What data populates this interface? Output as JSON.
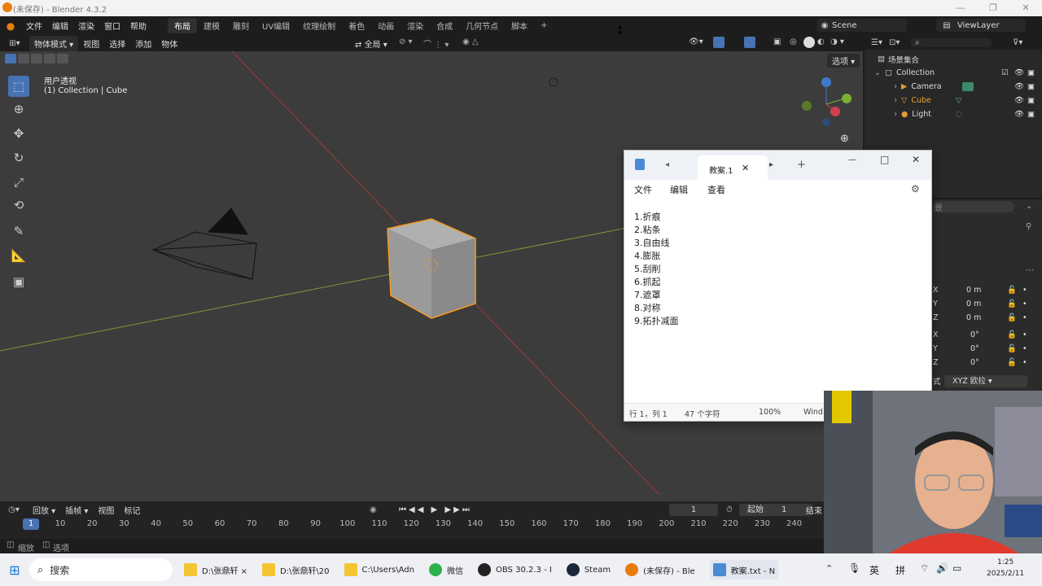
{
  "titlebar": {
    "title": "(未保存) - Blender 4.3.2"
  },
  "menu": [
    "文件",
    "编辑",
    "渲染",
    "窗口",
    "帮助"
  ],
  "workspaces": [
    "布局",
    "建模",
    "雕刻",
    "UV编辑",
    "纹理绘制",
    "着色",
    "动画",
    "渲染",
    "合成",
    "几何节点",
    "脚本"
  ],
  "scene": {
    "name": "Scene",
    "view_layer": "ViewLayer"
  },
  "viewport_header": {
    "mode": "物体模式",
    "menus": [
      "视图",
      "选择",
      "添加",
      "物体"
    ],
    "orientation": "全局",
    "options_label": "选项"
  },
  "viewport": {
    "view_name": "用户透视",
    "collection_info": "(1) Collection | Cube"
  },
  "outliner": {
    "root": "场景集合",
    "collection": "Collection",
    "items": [
      "Camera",
      "Cube",
      "Light"
    ]
  },
  "properties": {
    "axes": [
      "X",
      "Y",
      "Z",
      "X",
      "Y",
      "Z"
    ],
    "values": [
      "0 m",
      "0 m",
      "0 m",
      "0°",
      "0°",
      "0°"
    ],
    "rotation_mode": "XYZ 欧拉",
    "mode_suffix": "式",
    "cut_label": "景"
  },
  "notepad": {
    "tab_title": "教案.1",
    "menus": [
      "文件",
      "编辑",
      "查看"
    ],
    "lines": [
      "1.折痕",
      "2.粘条",
      "3.自由线",
      "4.膨胀",
      "5.刮削",
      "6.抓起",
      "7.遮罩",
      "8.对称",
      "9.拓扑减面"
    ],
    "status": {
      "position": "行 1，列 1",
      "chars": "47 个字符",
      "zoom": "100%",
      "encoding": "Wind"
    }
  },
  "timeline": {
    "menus": [
      "回放",
      "插帧",
      "视图",
      "标记"
    ],
    "current_frame": "1",
    "start_label": "起始",
    "start": "1",
    "end_label": "结束",
    "ticks": [
      "1",
      "10",
      "20",
      "30",
      "40",
      "50",
      "60",
      "70",
      "80",
      "90",
      "100",
      "110",
      "120",
      "130",
      "140",
      "150",
      "160",
      "170",
      "180",
      "190",
      "200",
      "210",
      "220",
      "230",
      "240"
    ]
  },
  "statusbar": {
    "left": "缩放",
    "right": "选项"
  },
  "taskbar": {
    "search": "搜索",
    "apps": [
      "D:\\张鼎轩 ×",
      "D:\\张鼎轩\\20",
      "C:\\Users\\Adn",
      "微信",
      "OBS 30.2.3 - I",
      "Steam",
      "(未保存) - Ble",
      "教案.txt - N"
    ],
    "ime": "英",
    "ime2": "拼",
    "time": "1:25",
    "date": "2025/2/11"
  }
}
